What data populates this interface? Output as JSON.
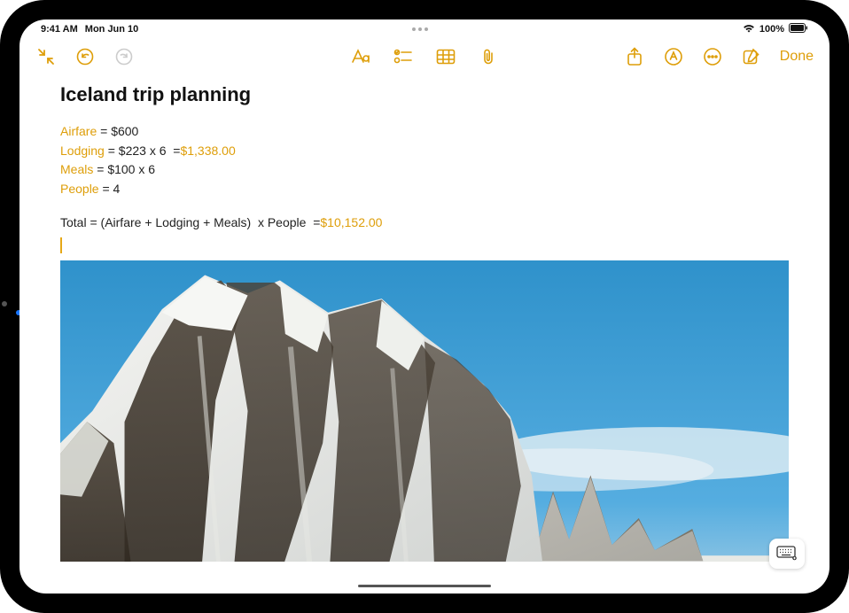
{
  "status_bar": {
    "time": "9:41 AM",
    "date": "Mon Jun 10",
    "battery_percent": "100%"
  },
  "toolbar": {
    "done_label": "Done"
  },
  "note": {
    "title": "Iceland trip planning",
    "airfare_name": "Airfare",
    "airfare_rest": " = $600",
    "lodging_name": "Lodging",
    "lodging_rest": " = $223 x 6  =",
    "lodging_result": "$1,338.00",
    "meals_name": "Meals",
    "meals_rest": " = $100 x 6",
    "people_name": "People",
    "people_rest": " = 4",
    "total_expr": "Total = (Airfare + Lodging + Meals)  x People  =",
    "total_result": "$10,152.00"
  },
  "colors": {
    "accent": "#DE9E09"
  }
}
